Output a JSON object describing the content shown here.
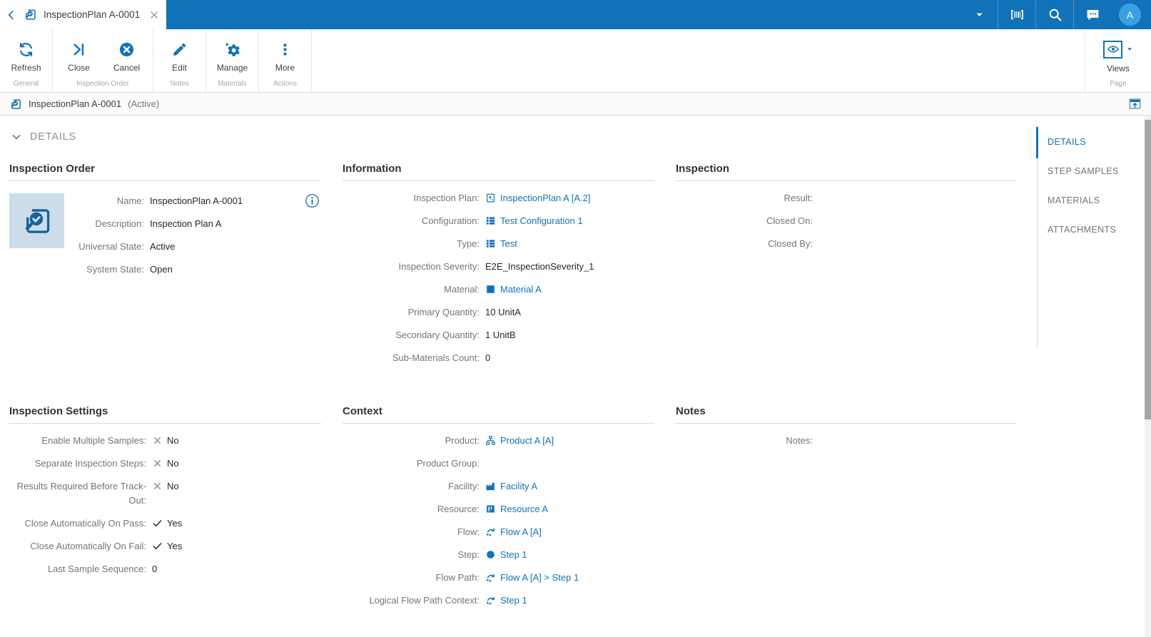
{
  "colors": {
    "topbar_blue": "#1272B9",
    "link_blue": "#1272B9",
    "avatar_blue": "#38A1E3",
    "label_gray": "#75757A",
    "nav_active_blue": "#1272B9"
  },
  "tab": {
    "title": "InspectionPlan A-0001"
  },
  "topbar": {
    "avatar_letter": "A"
  },
  "toolbar": {
    "groups": [
      {
        "label": "General",
        "buttons": [
          {
            "label": "Refresh",
            "icon": "refresh-icon"
          }
        ]
      },
      {
        "label": "Inspection Order",
        "buttons": [
          {
            "label": "Close",
            "icon": "close-track-icon"
          },
          {
            "label": "Cancel",
            "icon": "cancel-icon"
          }
        ]
      },
      {
        "label": "Notes",
        "buttons": [
          {
            "label": "Edit",
            "icon": "edit-pencil-icon"
          }
        ]
      },
      {
        "label": "Materials",
        "buttons": [
          {
            "label": "Manage",
            "icon": "manage-gear-icon"
          }
        ]
      },
      {
        "label": "Actions",
        "buttons": [
          {
            "label": "More",
            "icon": "more-ellipsis-icon"
          }
        ]
      }
    ],
    "page_group": {
      "label": "Page",
      "views_label": "Views"
    }
  },
  "titlebar": {
    "title": "InspectionPlan A-0001",
    "state": "(Active)"
  },
  "page": {
    "details_header": "DETAILS",
    "nav": {
      "items": [
        "DETAILS",
        "STEP SAMPLES",
        "MATERIALS",
        "ATTACHMENTS"
      ],
      "active_index": 0
    },
    "sections": {
      "inspection_order": {
        "title": "Inspection Order",
        "rows": [
          {
            "label": "Name:",
            "value": "InspectionPlan A-0001"
          },
          {
            "label": "Description:",
            "value": "Inspection Plan A"
          },
          {
            "label": "Universal State:",
            "value": "Active"
          },
          {
            "label": "System State:",
            "value": "Open"
          }
        ]
      },
      "information": {
        "title": "Information",
        "rows": [
          {
            "label": "Inspection Plan:",
            "value": "InspectionPlan A [A.2]",
            "icon": "inspection-plan-icon",
            "link": true
          },
          {
            "label": "Configuration:",
            "value": "Test Configuration 1",
            "icon": "list-icon",
            "link": true
          },
          {
            "label": "Type:",
            "value": "Test",
            "icon": "list-icon",
            "link": true
          },
          {
            "label": "Inspection Severity:",
            "value": "E2E_InspectionSeverity_1"
          },
          {
            "label": "Material:",
            "value": "Material A",
            "icon": "material-square-icon",
            "link": true
          },
          {
            "label": "Primary Quantity:",
            "value": "10 UnitA"
          },
          {
            "label": "Secondary Quantity:",
            "value": "1 UnitB"
          },
          {
            "label": "Sub-Materials Count:",
            "value": "0"
          }
        ]
      },
      "inspection": {
        "title": "Inspection",
        "rows": [
          {
            "label": "Result:",
            "value": ""
          },
          {
            "label": "Closed On:",
            "value": ""
          },
          {
            "label": "Closed By:",
            "value": ""
          }
        ]
      },
      "inspection_settings": {
        "title": "Inspection Settings",
        "rows": [
          {
            "label": "Enable Multiple Samples:",
            "value": "No",
            "icon": "x-icon"
          },
          {
            "label": "Separate Inspection Steps:",
            "value": "No",
            "icon": "x-icon"
          },
          {
            "label": "Results Required Before Track-Out:",
            "value": "No",
            "icon": "x-icon"
          },
          {
            "label": "Close Automatically On Pass:",
            "value": "Yes",
            "icon": "check-icon"
          },
          {
            "label": "Close Automatically On Fail:",
            "value": "Yes",
            "icon": "check-icon"
          },
          {
            "label": "Last Sample Sequence:",
            "value": "0"
          }
        ]
      },
      "context": {
        "title": "Context",
        "rows": [
          {
            "label": "Product:",
            "value": "Product A [A]",
            "icon": "product-icon",
            "link": true
          },
          {
            "label": "Product Group:",
            "value": ""
          },
          {
            "label": "Facility:",
            "value": "Facility A",
            "icon": "facility-icon",
            "link": true
          },
          {
            "label": "Resource:",
            "value": "Resource A",
            "icon": "resource-icon",
            "link": true
          },
          {
            "label": "Flow:",
            "value": "Flow A [A]",
            "icon": "flow-icon",
            "link": true
          },
          {
            "label": "Step:",
            "value": "Step 1",
            "icon": "step-circle-icon",
            "link": true
          },
          {
            "label": "Flow Path:",
            "value": "Flow A [A] > Step 1",
            "icon": "flow-icon",
            "link": true
          },
          {
            "label": "Logical Flow Path Context:",
            "value": "Step 1",
            "icon": "flow-icon",
            "link": true
          }
        ]
      },
      "notes": {
        "title": "Notes",
        "rows": [
          {
            "label": "Notes:",
            "value": ""
          }
        ]
      }
    }
  }
}
